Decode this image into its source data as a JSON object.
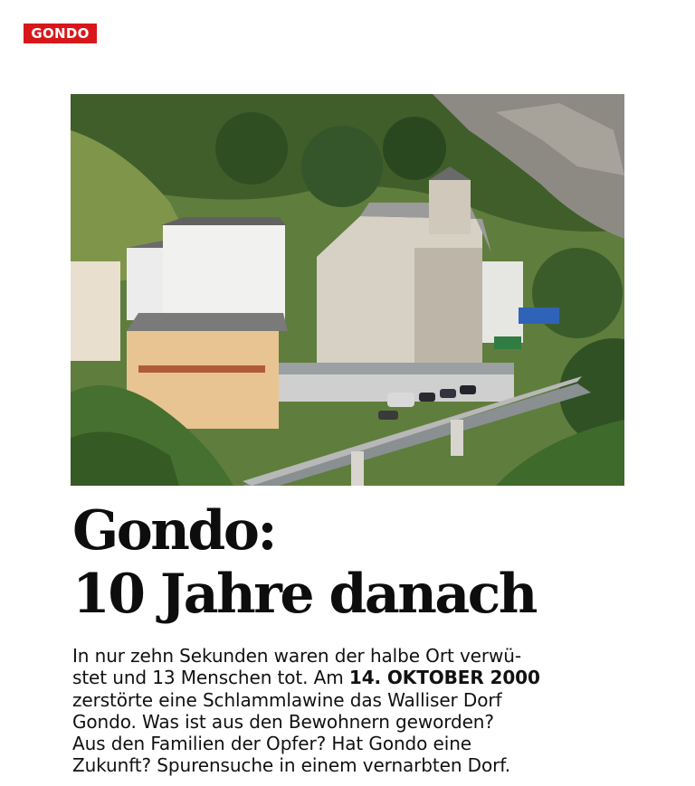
{
  "section_tag": "GONDO",
  "headline": {
    "line1": "Gondo:",
    "line2": "10 Jahre danach"
  },
  "lead": {
    "line1": "In nur zehn Sekunden waren der halbe Ort verwü-",
    "line2_pre": "stet und 13 Menschen tot. Am ",
    "line2_bold": "14. OKTOBER 2000",
    "line3": "zerstörte eine Schlammlawine das Walliser Dorf",
    "line4": "Gondo.  Was ist aus den Bewohnern geworden?",
    "line5": "Aus den Familien der Opfer? Hat Gondo eine",
    "line6": "Zukunft? Spurensuche in einem vernarbten Dorf."
  },
  "colors": {
    "tag_background": "#d8171b",
    "tag_text": "#ffffff",
    "text": "#111111"
  }
}
